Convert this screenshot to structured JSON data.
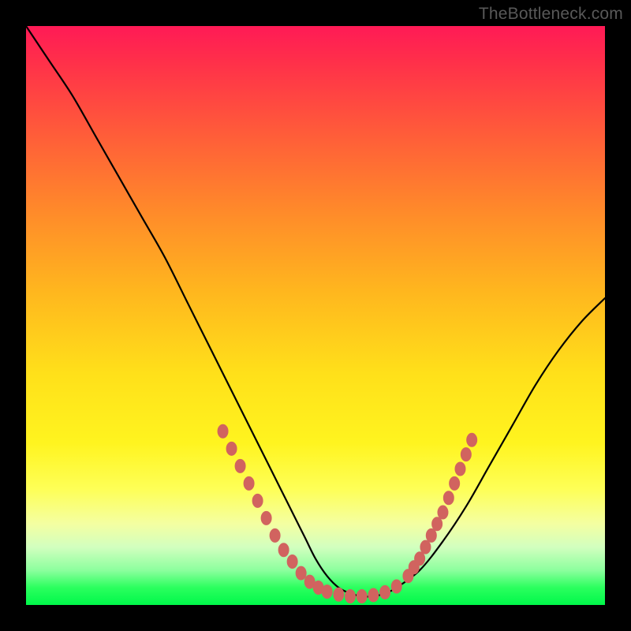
{
  "watermark": "TheBottleneck.com",
  "chart_data": {
    "type": "line",
    "title": "",
    "xlabel": "",
    "ylabel": "",
    "xlim": [
      0,
      100
    ],
    "ylim": [
      0,
      100
    ],
    "grid": false,
    "legend": false,
    "series": [
      {
        "name": "bottleneck-curve",
        "x": [
          0,
          4,
          8,
          12,
          16,
          20,
          24,
          28,
          32,
          36,
          40,
          44,
          48,
          50,
          52,
          54,
          56,
          58,
          60,
          62,
          64,
          68,
          72,
          76,
          80,
          84,
          88,
          92,
          96,
          100
        ],
        "y": [
          100,
          94,
          88,
          81,
          74,
          67,
          60,
          52,
          44,
          36,
          28,
          20,
          12,
          8,
          5,
          3,
          2,
          1.5,
          1.5,
          2,
          3,
          6,
          11,
          17,
          24,
          31,
          38,
          44,
          49,
          53
        ]
      }
    ],
    "markers": {
      "name": "highlight-dots",
      "color": "#d1635f",
      "points": [
        {
          "x": 34,
          "y": 30
        },
        {
          "x": 35.5,
          "y": 27
        },
        {
          "x": 37,
          "y": 24
        },
        {
          "x": 38.5,
          "y": 21
        },
        {
          "x": 40,
          "y": 18
        },
        {
          "x": 41.5,
          "y": 15
        },
        {
          "x": 43,
          "y": 12
        },
        {
          "x": 44.5,
          "y": 9.5
        },
        {
          "x": 46,
          "y": 7.5
        },
        {
          "x": 47.5,
          "y": 5.5
        },
        {
          "x": 49,
          "y": 4
        },
        {
          "x": 50.5,
          "y": 3
        },
        {
          "x": 52,
          "y": 2.3
        },
        {
          "x": 54,
          "y": 1.8
        },
        {
          "x": 56,
          "y": 1.5
        },
        {
          "x": 58,
          "y": 1.5
        },
        {
          "x": 60,
          "y": 1.7
        },
        {
          "x": 62,
          "y": 2.2
        },
        {
          "x": 64,
          "y": 3.2
        },
        {
          "x": 66,
          "y": 5
        },
        {
          "x": 67,
          "y": 6.5
        },
        {
          "x": 68,
          "y": 8
        },
        {
          "x": 69,
          "y": 10
        },
        {
          "x": 70,
          "y": 12
        },
        {
          "x": 71,
          "y": 14
        },
        {
          "x": 72,
          "y": 16
        },
        {
          "x": 73,
          "y": 18.5
        },
        {
          "x": 74,
          "y": 21
        },
        {
          "x": 75,
          "y": 23.5
        },
        {
          "x": 76,
          "y": 26
        },
        {
          "x": 77,
          "y": 28.5
        }
      ]
    }
  }
}
